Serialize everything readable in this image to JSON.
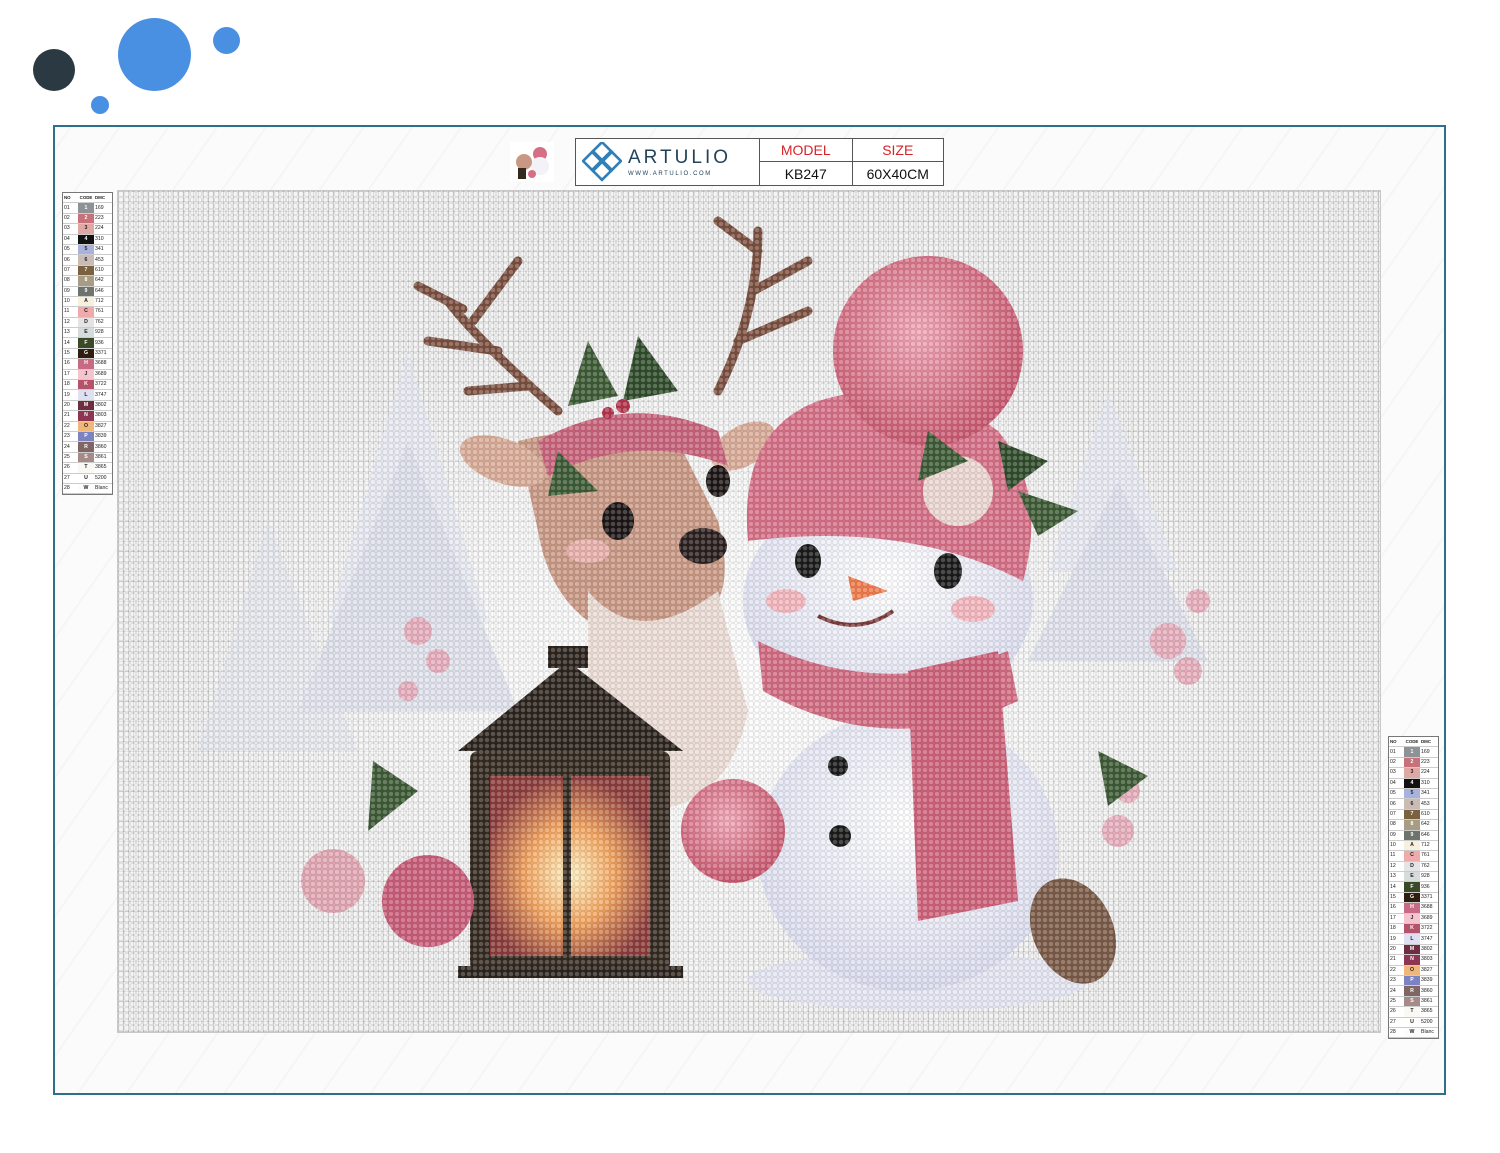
{
  "brand": {
    "name": "ARTULIO",
    "url": "WWW.ARTULIO.COM"
  },
  "spec": {
    "model_label": "MODEL",
    "size_label": "SIZE",
    "model": "KB247",
    "size": "60X40CM"
  },
  "legend_headers": [
    "NO",
    "CODE",
    "DMC"
  ],
  "colors": {
    "frame": "#2e6f8c",
    "dot_dark": "#2b3a42",
    "dot_blue": "#4a90e2",
    "label_red": "#d8232a"
  },
  "legend": [
    {
      "no": "01",
      "code": "1",
      "dmc": "169",
      "color": "#8d9296"
    },
    {
      "no": "02",
      "code": "2",
      "dmc": "223",
      "color": "#c7727a"
    },
    {
      "no": "03",
      "code": "3",
      "dmc": "224",
      "color": "#e0a8a4"
    },
    {
      "no": "04",
      "code": "4",
      "dmc": "310",
      "color": "#111111"
    },
    {
      "no": "05",
      "code": "5",
      "dmc": "341",
      "color": "#a9b2dc"
    },
    {
      "no": "06",
      "code": "6",
      "dmc": "453",
      "color": "#c9bbb6"
    },
    {
      "no": "07",
      "code": "7",
      "dmc": "610",
      "color": "#7a6140"
    },
    {
      "no": "08",
      "code": "8",
      "dmc": "642",
      "color": "#a89d84"
    },
    {
      "no": "09",
      "code": "9",
      "dmc": "646",
      "color": "#6e736d"
    },
    {
      "no": "10",
      "code": "A",
      "dmc": "712",
      "color": "#f6f0dd"
    },
    {
      "no": "11",
      "code": "C",
      "dmc": "761",
      "color": "#efaaaa"
    },
    {
      "no": "12",
      "code": "D",
      "dmc": "762",
      "color": "#e4e4e4"
    },
    {
      "no": "13",
      "code": "E",
      "dmc": "928",
      "color": "#d6dcdc"
    },
    {
      "no": "14",
      "code": "F",
      "dmc": "936",
      "color": "#3b4a26"
    },
    {
      "no": "15",
      "code": "G",
      "dmc": "3371",
      "color": "#2f1e10"
    },
    {
      "no": "16",
      "code": "H",
      "dmc": "3688",
      "color": "#c86a84"
    },
    {
      "no": "17",
      "code": "J",
      "dmc": "3689",
      "color": "#f5c5cf"
    },
    {
      "no": "18",
      "code": "K",
      "dmc": "3722",
      "color": "#b4536a"
    },
    {
      "no": "19",
      "code": "L",
      "dmc": "3747",
      "color": "#dfe1f2"
    },
    {
      "no": "20",
      "code": "M",
      "dmc": "3802",
      "color": "#6e2d40"
    },
    {
      "no": "21",
      "code": "N",
      "dmc": "3803",
      "color": "#8f3554"
    },
    {
      "no": "22",
      "code": "O",
      "dmc": "3827",
      "color": "#f0b77a"
    },
    {
      "no": "23",
      "code": "P",
      "dmc": "3839",
      "color": "#7b83c2"
    },
    {
      "no": "24",
      "code": "R",
      "dmc": "3860",
      "color": "#7f6563"
    },
    {
      "no": "25",
      "code": "S",
      "dmc": "3861",
      "color": "#a68a88"
    },
    {
      "no": "26",
      "code": "T",
      "dmc": "3865",
      "color": "#f9f8f2"
    },
    {
      "no": "27",
      "code": "U",
      "dmc": "5200",
      "color": "#ffffff"
    },
    {
      "no": "28",
      "code": "W",
      "dmc": "Blanc",
      "color": "#fcfcfc"
    }
  ]
}
